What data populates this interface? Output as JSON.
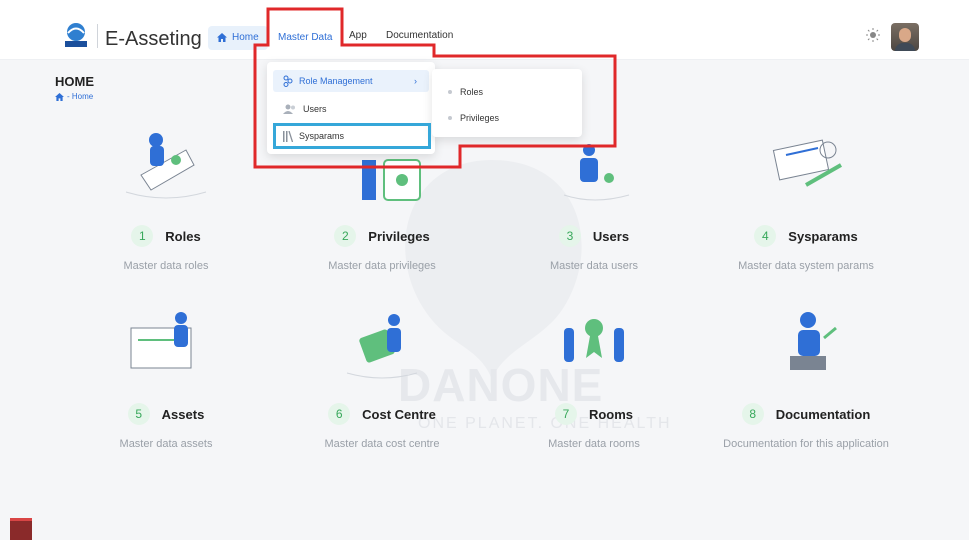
{
  "app": {
    "brand": "E-Asseting"
  },
  "nav": {
    "home": "Home",
    "master_data": "Master Data",
    "app": "App",
    "documentation": "Documentation"
  },
  "page": {
    "title": "HOME",
    "breadcrumb": "- Home"
  },
  "dropdown": {
    "items": [
      {
        "label": "Role Management",
        "icon": "role-management-icon"
      },
      {
        "label": "Users",
        "icon": "users-icon"
      },
      {
        "label": "Sysparams",
        "icon": "sysparams-icon"
      }
    ],
    "submenu": [
      "Roles",
      "Privileges"
    ]
  },
  "cards": [
    {
      "num": "1",
      "title": "Roles",
      "sub": "Master data roles"
    },
    {
      "num": "2",
      "title": "Privileges",
      "sub": "Master data privileges"
    },
    {
      "num": "3",
      "title": "Users",
      "sub": "Master data users"
    },
    {
      "num": "4",
      "title": "Sysparams",
      "sub": "Master data system params"
    },
    {
      "num": "5",
      "title": "Assets",
      "sub": "Master data assets"
    },
    {
      "num": "6",
      "title": "Cost Centre",
      "sub": "Master data cost centre"
    },
    {
      "num": "7",
      "title": "Rooms",
      "sub": "Master data rooms"
    },
    {
      "num": "8",
      "title": "Documentation",
      "sub": "Documentation for this application"
    }
  ],
  "watermark": {
    "text": "DANONE",
    "sub": "ONE PLANET. ONE HEALTH"
  },
  "colors": {
    "accent": "#2f6fd6",
    "number_green": "#37a85a",
    "highlight_red": "#e0282a",
    "highlight_blue": "#35a7d9"
  }
}
